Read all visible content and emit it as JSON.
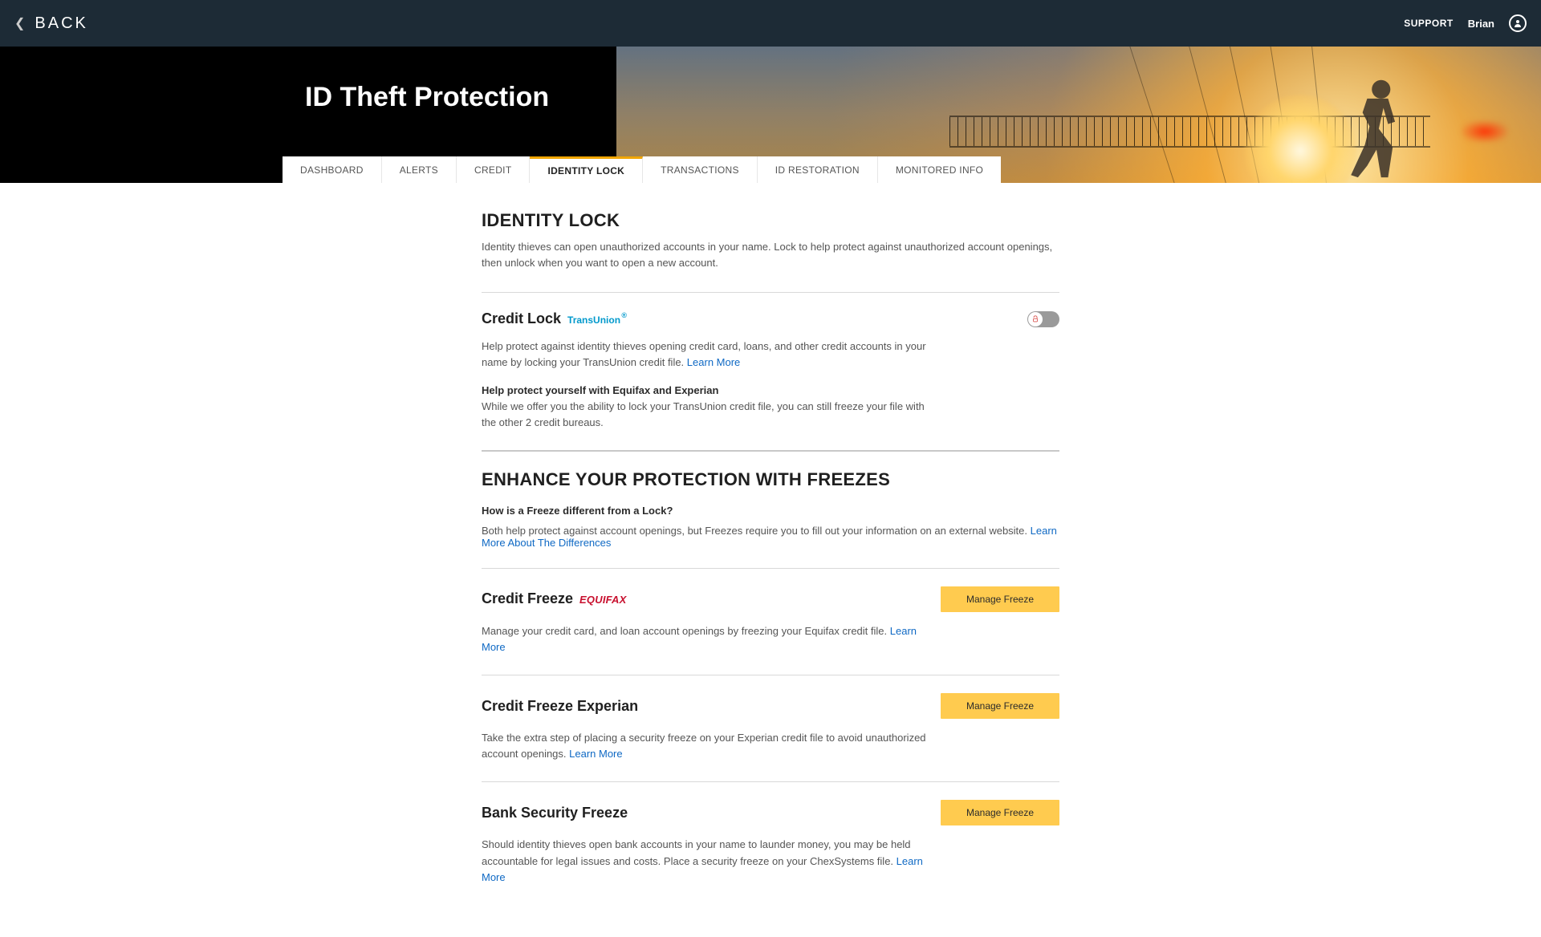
{
  "topbar": {
    "back": "BACK",
    "support": "SUPPORT",
    "user": "Brian"
  },
  "hero": {
    "title": "ID Theft Protection"
  },
  "tabs": [
    {
      "label": "DASHBOARD",
      "active": false
    },
    {
      "label": "ALERTS",
      "active": false
    },
    {
      "label": "CREDIT",
      "active": false
    },
    {
      "label": "IDENTITY LOCK",
      "active": true
    },
    {
      "label": "TRANSACTIONS",
      "active": false
    },
    {
      "label": "ID RESTORATION",
      "active": false
    },
    {
      "label": "MONITORED INFO",
      "active": false
    }
  ],
  "identity_lock": {
    "title": "IDENTITY LOCK",
    "desc": "Identity thieves can open unauthorized accounts in your name. Lock to help protect against unauthorized account openings, then unlock when you want to open a new account."
  },
  "credit_lock": {
    "title": "Credit Lock",
    "provider": "TransUnion",
    "toggle_on": false,
    "desc": "Help protect against identity thieves opening credit card, loans, and other credit accounts in your name by locking your TransUnion credit file. ",
    "learn_more": "Learn More",
    "sub_heading": "Help protect yourself with Equifax and Experian",
    "sub_text": "While we offer you the ability to lock your TransUnion credit file, you can still freeze your file with the other 2 credit bureaus."
  },
  "freezes": {
    "title": "ENHANCE YOUR PROTECTION WITH FREEZES",
    "question": "How is a Freeze different from a Lock?",
    "answer": "Both help protect against account openings, but Freezes require you to fill out your information on an external website. ",
    "learn_more": "Learn More About The Differences"
  },
  "freeze_items": [
    {
      "title": "Credit Freeze",
      "provider_type": "equifax",
      "provider_label": "EQUIFAX",
      "desc": "Manage your credit card, and loan account openings by freezing your Equifax credit file. ",
      "learn_more": "Learn More",
      "button": "Manage Freeze"
    },
    {
      "title": "Credit Freeze Experian",
      "provider_type": "none",
      "provider_label": "",
      "desc": "Take the extra step of placing a security freeze on your Experian credit file to avoid unauthorized account openings. ",
      "learn_more": "Learn More",
      "button": "Manage Freeze"
    },
    {
      "title": "Bank Security Freeze",
      "provider_type": "none",
      "provider_label": "",
      "desc": "Should identity thieves open bank accounts in your name to launder money, you may be held accountable for legal issues and costs. Place a security freeze on your ChexSystems file. ",
      "learn_more": "Learn More",
      "button": "Manage Freeze"
    }
  ]
}
